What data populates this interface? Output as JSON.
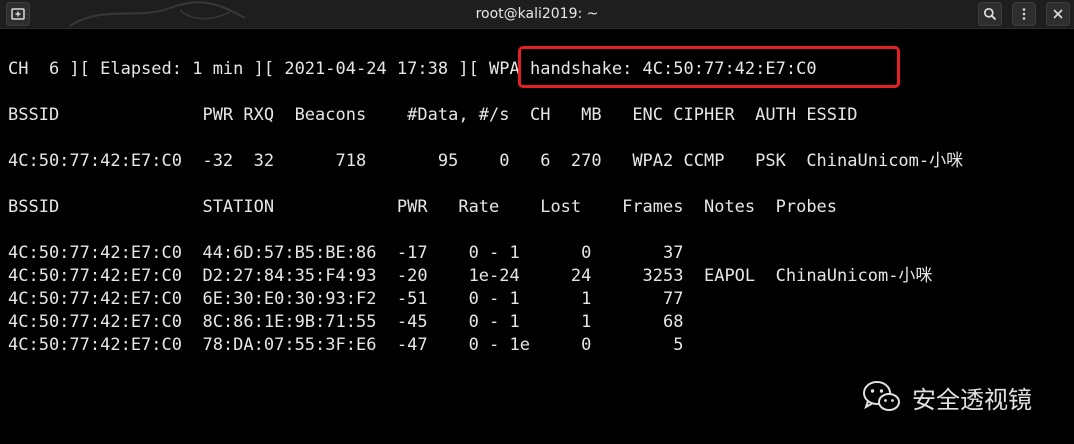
{
  "window": {
    "title": "root@kali2019: ~"
  },
  "terminal": {
    "status_line": "CH  6 ][ Elapsed: 1 min ][ 2021-04-24 17:38 ][ WPA handshake: 4C:50:77:42:E7:C0",
    "ap_header": "BSSID              PWR RXQ  Beacons    #Data, #/s  CH   MB   ENC CIPHER  AUTH ESSID",
    "ap_rows": [
      "4C:50:77:42:E7:C0  -32  32      718       95    0   6  270   WPA2 CCMP   PSK  ChinaUnicom-小咪"
    ],
    "station_header": "BSSID              STATION            PWR   Rate    Lost    Frames  Notes  Probes",
    "station_rows": [
      "4C:50:77:42:E7:C0  44:6D:57:B5:BE:86  -17    0 - 1      0       37",
      "4C:50:77:42:E7:C0  D2:27:84:35:F4:93  -20    1e-24     24     3253  EAPOL  ChinaUnicom-小咪",
      "4C:50:77:42:E7:C0  6E:30:E0:30:93:F2  -51    0 - 1      1       77",
      "4C:50:77:42:E7:C0  8C:86:1E:9B:71:55  -45    0 - 1      1       68",
      "4C:50:77:42:E7:C0  78:DA:07:55:3F:E6  -47    0 - 1e     0        5"
    ]
  },
  "watermark": {
    "text": "安全透视镜",
    "icon": "wechat-icon"
  },
  "colors": {
    "background": "#000000",
    "text": "#e6e6e6",
    "highlight": "#e42020"
  }
}
